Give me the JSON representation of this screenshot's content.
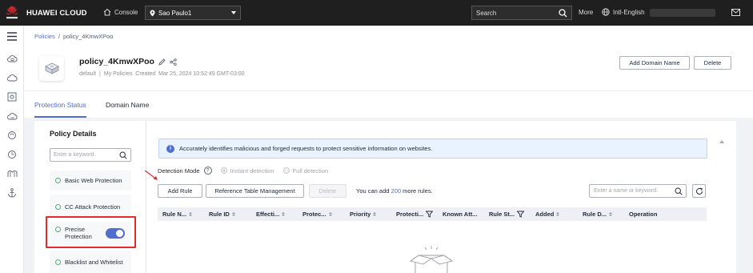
{
  "topbar": {
    "brand": "HUAWEI CLOUD",
    "console_label": "Console",
    "region": "Sao Paulo1",
    "search_placeholder": "Search",
    "more_label": "More",
    "language": "Intl-English"
  },
  "breadcrumb": {
    "root": "Policies",
    "separator": "/",
    "current": "policy_4KmwXPoo"
  },
  "policy": {
    "name": "policy_4KmwXPoo",
    "meta_default": "default",
    "meta_sep": "|",
    "meta_owner": "My Policies",
    "meta_created_label": "Created",
    "meta_created": "Mar 25, 2024 10:52:49 GMT-03:00"
  },
  "header_buttons": {
    "add_domain": "Add Domain Name",
    "delete": "Delete"
  },
  "tabs": [
    {
      "label": "Protection Status",
      "active": true
    },
    {
      "label": "Domain Name",
      "active": false
    }
  ],
  "left_panel": {
    "title": "Policy Details",
    "search_placeholder": "Enter a keyword.",
    "items": [
      {
        "label": "Basic Web Protection"
      },
      {
        "label": "CC Attack Protection"
      },
      {
        "label": "Precise Protection",
        "label_line1": "Precise",
        "label_line2": "Protection",
        "toggle_on": true
      },
      {
        "label": "Blacklist and Whitelist"
      }
    ]
  },
  "info": {
    "icon": "i",
    "text": "Accurately identifies malicious and forged requests to protect sensitive information on websites."
  },
  "detection": {
    "label": "Detection Mode",
    "help": "?",
    "option_instant": "Instant detection",
    "option_full": "Full detection"
  },
  "toolbar": {
    "add_rule": "Add Rule",
    "reference_table": "Reference Table Management",
    "delete": "Delete",
    "hint_prefix": "You can add",
    "hint_count": "200",
    "hint_suffix": "more rules.",
    "name_search_placeholder": "Enter a name or keyword."
  },
  "table": {
    "columns": [
      "Rule N...",
      "Rule ID",
      "Effecti...",
      "Protec...",
      "Priority",
      "Protecti...",
      "Known Att...",
      "Rule St...",
      "Added",
      "Rule D...",
      "Operation"
    ]
  },
  "colors": {
    "accent": "#526ecc",
    "topbar": "#1f1f1f",
    "highlight": "#e32b2b",
    "status_green": "#50b371"
  }
}
